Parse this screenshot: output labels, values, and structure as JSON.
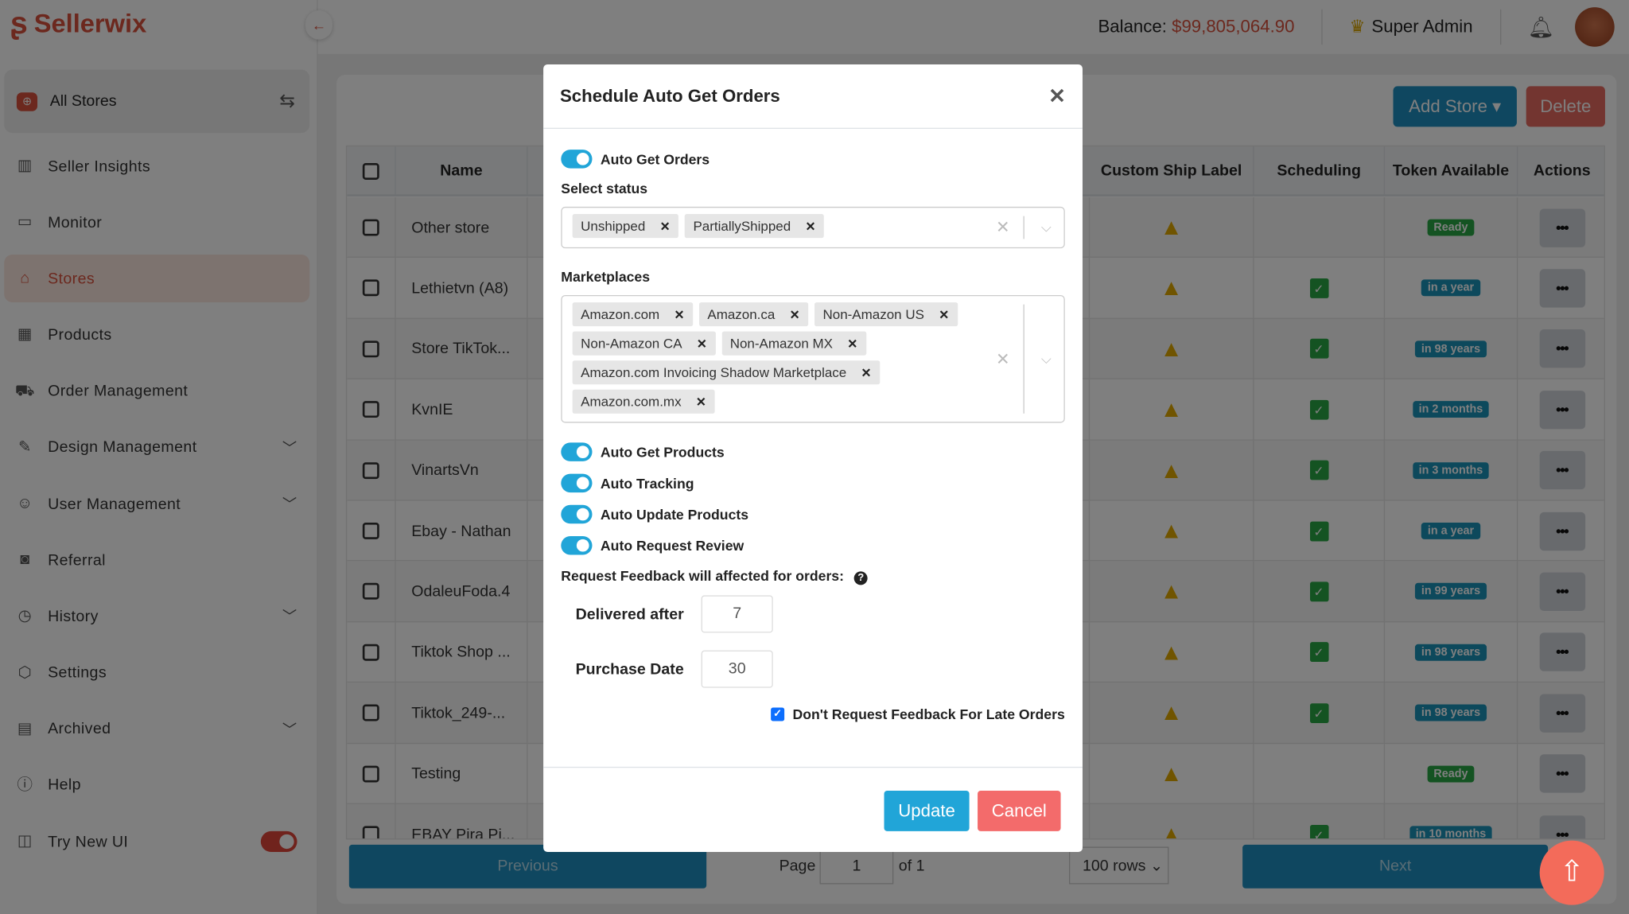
{
  "brand": {
    "name": "Sellerwix"
  },
  "topbar": {
    "balance_label": "Balance:",
    "balance_value": "$99,805,064.90",
    "role": "Super Admin"
  },
  "sidebar": {
    "all_stores": "All Stores",
    "items": [
      {
        "label": "Seller Insights",
        "icon": "bar-chart-icon",
        "glyph": "▥"
      },
      {
        "label": "Monitor",
        "icon": "monitor-icon",
        "glyph": "▭"
      },
      {
        "label": "Stores",
        "icon": "store-icon",
        "glyph": "⌂",
        "active": true
      },
      {
        "label": "Products",
        "icon": "grid-icon",
        "glyph": "▦"
      },
      {
        "label": "Order Management",
        "icon": "cart-icon",
        "glyph": "⛟"
      },
      {
        "label": "Design Management",
        "icon": "design-icon",
        "glyph": "✎",
        "chevron": true
      },
      {
        "label": "User Management",
        "icon": "users-icon",
        "glyph": "☺",
        "chevron": true
      },
      {
        "label": "Referral",
        "icon": "referral-icon",
        "glyph": "◙"
      },
      {
        "label": "History",
        "icon": "clock-icon",
        "glyph": "◷",
        "chevron": true
      },
      {
        "label": "Settings",
        "icon": "settings-icon",
        "glyph": "⬡"
      },
      {
        "label": "Archived",
        "icon": "archive-icon",
        "glyph": "▤",
        "chevron": true
      },
      {
        "label": "Help",
        "icon": "help-icon",
        "glyph": "ⓘ"
      },
      {
        "label": "Try New UI",
        "icon": "layout-icon",
        "glyph": "◫",
        "toggle": true
      }
    ]
  },
  "toolbar": {
    "add_store": "Add Store",
    "delete": "Delete"
  },
  "table": {
    "columns": [
      "Name",
      "Custom Ship Label",
      "Scheduling",
      "Token Available",
      "Actions"
    ],
    "rows": [
      {
        "name": "Other store",
        "scheduled": false,
        "token": "Ready",
        "token_color": "#28a745"
      },
      {
        "name": "Lethietvn (A8)",
        "scheduled": true,
        "token": "in a year",
        "token_color": "#1a93b8"
      },
      {
        "name": "Store TikTok...",
        "scheduled": true,
        "token": "in 98 years",
        "token_color": "#1a93b8"
      },
      {
        "name": "KvnIE",
        "scheduled": true,
        "token": "in 2 months",
        "token_color": "#1a93b8"
      },
      {
        "name": "VinartsVn",
        "scheduled": true,
        "token": "in 3 months",
        "token_color": "#1a93b8"
      },
      {
        "name": "Ebay - Nathan",
        "scheduled": true,
        "token": "in a year",
        "token_color": "#1a93b8"
      },
      {
        "name": "OdaleuFoda.4",
        "scheduled": true,
        "token": "in 99 years",
        "token_color": "#1a93b8"
      },
      {
        "name": "Tiktok Shop ...",
        "scheduled": true,
        "token": "in 98 years",
        "token_color": "#1a93b8"
      },
      {
        "name": "Tiktok_249-...",
        "scheduled": true,
        "token": "in 98 years",
        "token_color": "#1a93b8"
      },
      {
        "name": "Testing",
        "scheduled": false,
        "token": "Ready",
        "token_color": "#28a745"
      },
      {
        "name": "EBAY Pira Pi...",
        "scheduled": true,
        "token": "in 10 months",
        "token_color": "#1a93b8"
      }
    ]
  },
  "pager": {
    "previous": "Previous",
    "page_label": "Page",
    "page": "1",
    "of": "of 1",
    "rows": "100 rows",
    "next": "Next"
  },
  "modal": {
    "title": "Schedule Auto Get Orders",
    "auto_get_orders": {
      "label": "Auto Get Orders",
      "on": true
    },
    "status_label": "Select status",
    "statuses": [
      "Unshipped",
      "PartiallyShipped"
    ],
    "marketplaces_label": "Marketplaces",
    "marketplaces": [
      "Amazon.com",
      "Amazon.ca",
      "Non-Amazon US",
      "Non-Amazon CA",
      "Non-Amazon MX",
      "Amazon.com Invoicing Shadow Marketplace",
      "Amazon.com.mx"
    ],
    "toggles": [
      {
        "label": "Auto Get Products",
        "on": true
      },
      {
        "label": "Auto Tracking",
        "on": true
      },
      {
        "label": "Auto Update Products",
        "on": true
      },
      {
        "label": "Auto Request Review",
        "on": true
      }
    ],
    "feedback_label": "Request Feedback will affected for orders:",
    "delivered_after": {
      "label": "Delivered after",
      "value": "7"
    },
    "purchase_date": {
      "label": "Purchase Date",
      "value": "30"
    },
    "late_orders": {
      "label": "Don't Request Feedback For Late Orders",
      "checked": true
    },
    "update": "Update",
    "cancel": "Cancel"
  },
  "colors": {
    "brand": "#d9513d",
    "primary": "#21a5d8",
    "danger": "#f36b6b"
  }
}
